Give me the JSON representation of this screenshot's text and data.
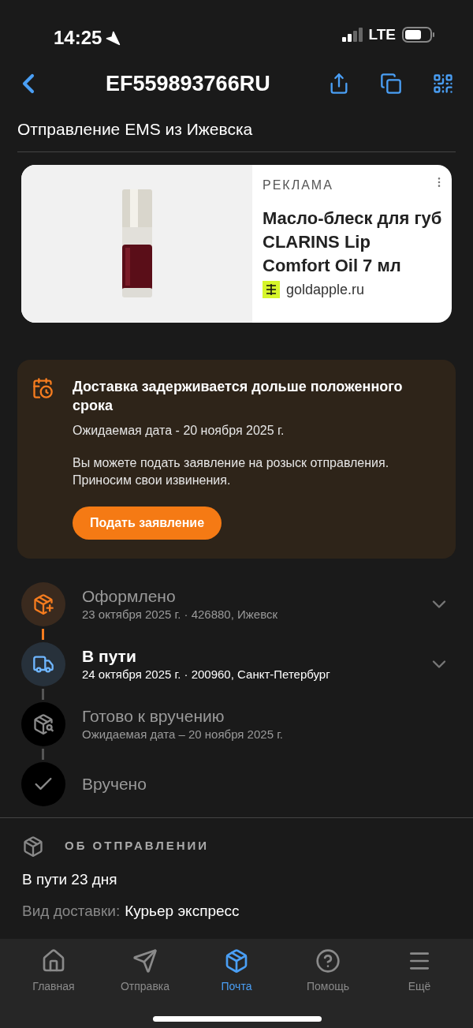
{
  "status_bar": {
    "time": "14:25",
    "network": "LTE"
  },
  "header": {
    "title": "EF559893766RU"
  },
  "subtitle": "Отправление EMS из Ижевска",
  "ad": {
    "label": "РЕКЛАМА",
    "title": "Масло-блеск для губ CLARINS Lip Comfort Oil 7 мл",
    "domain": "goldapple.ru"
  },
  "notice": {
    "title": "Доставка задерживается дольше положенного срока",
    "expected": "Ожидаемая дата - 20 ноября 2025 г.",
    "message": "Вы можете подать заявление на розыск отправления. Приносим свои извинения.",
    "button": "Подать заявление"
  },
  "timeline": [
    {
      "kind": "created",
      "done": true,
      "current": false,
      "title": "Оформлено",
      "detail": "23 октября 2025 г. · 426880, Ижевск",
      "expandable": true
    },
    {
      "kind": "transit",
      "done": false,
      "current": true,
      "title": "В пути",
      "detail": "24 октября 2025 г. · 200960, Санкт-Петербург",
      "expandable": true
    },
    {
      "kind": "ready",
      "done": false,
      "current": false,
      "title": "Готово к вручению",
      "detail": "Ожидаемая дата – 20 ноября 2025 г.",
      "expandable": false
    },
    {
      "kind": "delivered",
      "done": false,
      "current": false,
      "title": "Вручено",
      "expandable": false
    }
  ],
  "about": {
    "heading": "ОБ ОТПРАВЛЕНИИ",
    "duration": "В пути 23 дня",
    "delivery_label": "Вид доставки:",
    "delivery_value": "Курьер экспресс"
  },
  "tabs": [
    {
      "kind": "home",
      "label": "Главная",
      "selected": false
    },
    {
      "kind": "send",
      "label": "Отправка",
      "selected": false
    },
    {
      "kind": "mail",
      "label": "Почта",
      "selected": true
    },
    {
      "kind": "help",
      "label": "Помощь",
      "selected": false
    },
    {
      "kind": "more",
      "label": "Ещё",
      "selected": false
    }
  ]
}
